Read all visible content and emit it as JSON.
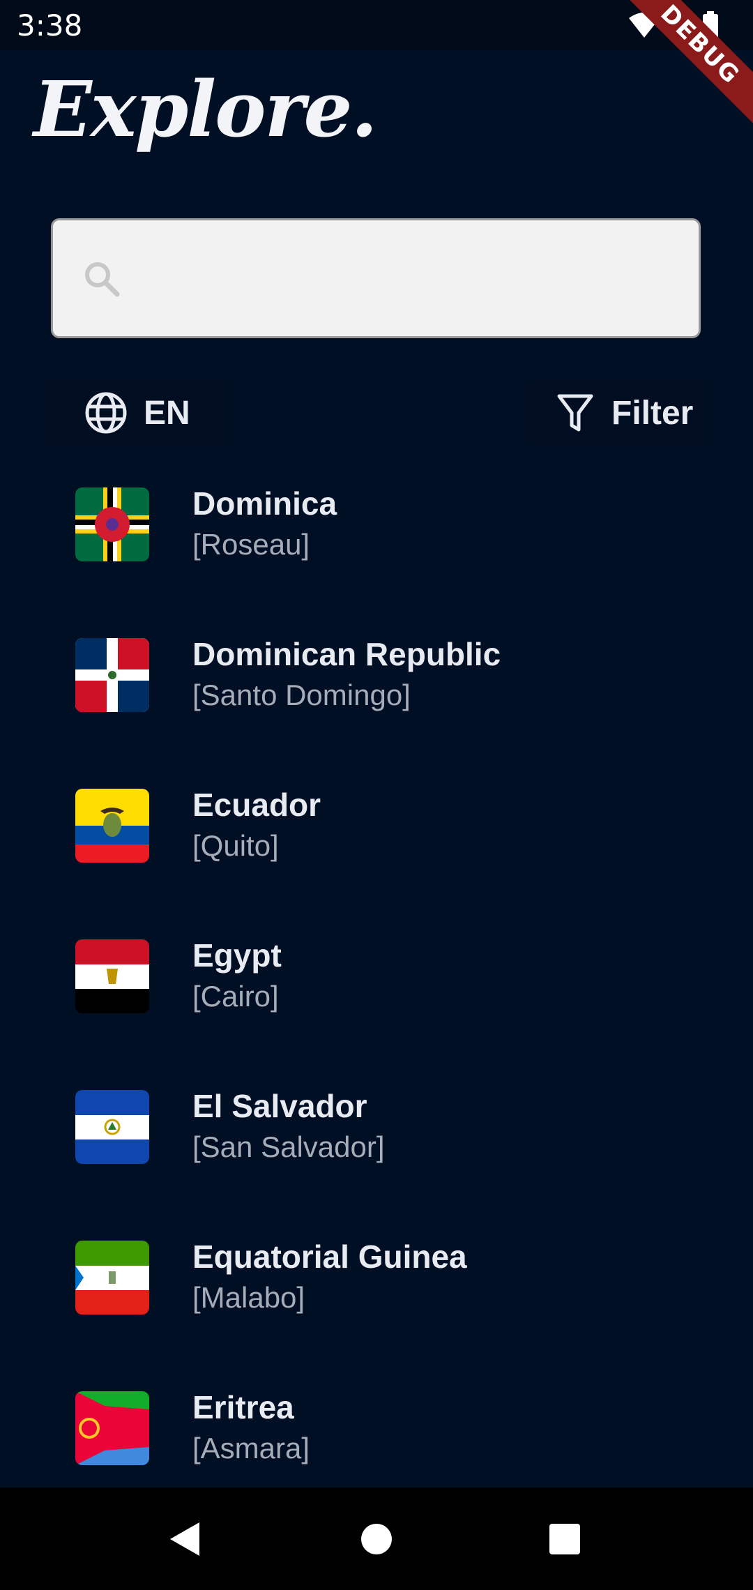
{
  "status": {
    "time": "3:38",
    "debug_label": "DEBUG",
    "icons": [
      "wifi-icon",
      "signal-icon",
      "battery-icon"
    ]
  },
  "app": {
    "logo": "Explore."
  },
  "search": {
    "value": "",
    "placeholder": "",
    "icon": "search-icon"
  },
  "controls": {
    "language_label": "EN",
    "language_icon": "globe-icon",
    "filter_label": "Filter",
    "filter_icon": "filter-icon"
  },
  "countries": [
    {
      "name": "Dominica",
      "capital": "[Roseau]"
    },
    {
      "name": "Dominican Republic",
      "capital": "[Santo Domingo]"
    },
    {
      "name": "Ecuador",
      "capital": "[Quito]"
    },
    {
      "name": "Egypt",
      "capital": "[Cairo]"
    },
    {
      "name": "El Salvador",
      "capital": "[San Salvador]"
    },
    {
      "name": "Equatorial Guinea",
      "capital": "[Malabo]"
    },
    {
      "name": "Eritrea",
      "capital": "[Asmara]"
    }
  ],
  "nav": {
    "buttons": [
      "back-icon",
      "home-icon",
      "recents-icon"
    ]
  },
  "colors": {
    "background": "#000f24",
    "search_bg": "#f2f2f2",
    "debug_ribbon": "#8b1a1a"
  }
}
